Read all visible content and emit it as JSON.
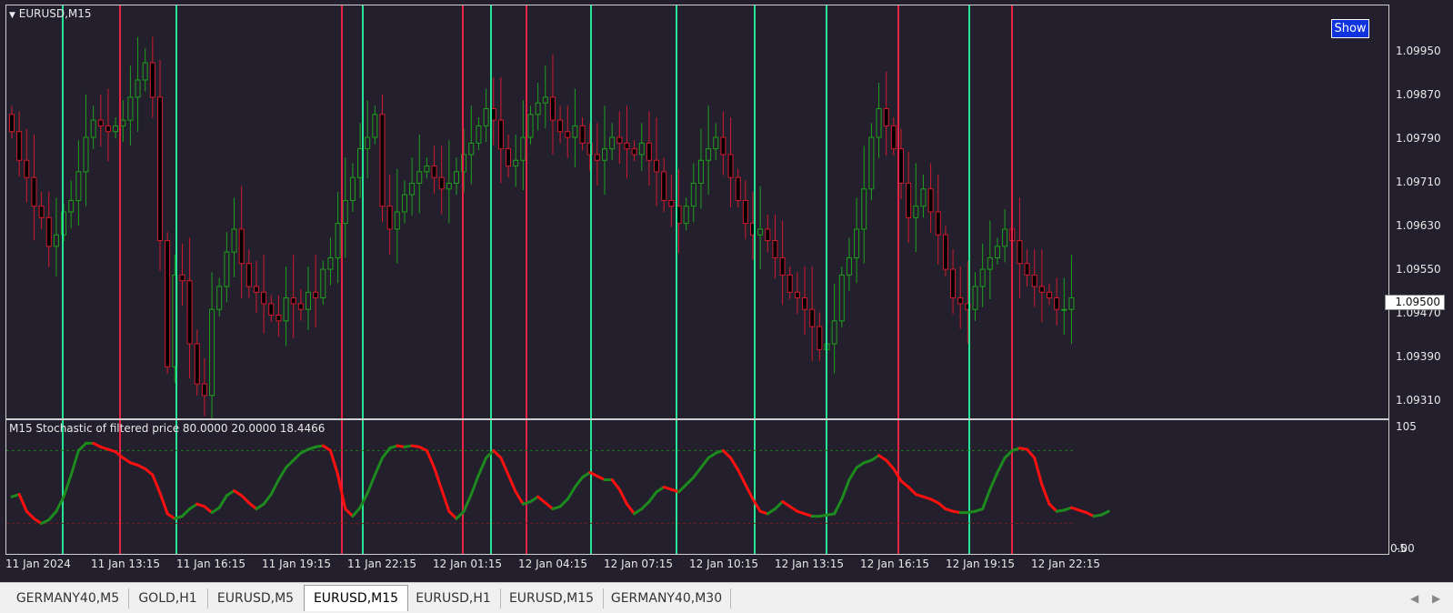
{
  "window": {
    "title": "EURUSD,M15",
    "show_button": "Show",
    "current_price": "1.09500"
  },
  "price_axis": [
    "1.09950",
    "1.09870",
    "1.09790",
    "1.09710",
    "1.09630",
    "1.09550",
    "1.09470",
    "1.09390",
    "1.09310"
  ],
  "indicator": {
    "label": "M15 Stochastic of filtered price 80.0000 20.0000 18.4466",
    "axis_top": "105",
    "axis_bottom": "-5",
    "axis_bottom_overlay": "0.00"
  },
  "time_axis": [
    "11 Jan 2024",
    "11 Jan 13:15",
    "11 Jan 16:15",
    "11 Jan 19:15",
    "11 Jan 22:15",
    "12 Jan 01:15",
    "12 Jan 04:15",
    "12 Jan 07:15",
    "12 Jan 10:15",
    "12 Jan 13:15",
    "12 Jan 16:15",
    "12 Jan 19:15",
    "12 Jan 22:15"
  ],
  "tabs": [
    {
      "label": "GERMANY40,M5"
    },
    {
      "label": "GOLD,H1"
    },
    {
      "label": "EURUSD,M5"
    },
    {
      "label": "EURUSD,M15",
      "active": true
    },
    {
      "label": "EURUSD,H1"
    },
    {
      "label": "EURUSD,M15"
    },
    {
      "label": "GERMANY40,M30"
    }
  ],
  "colors": {
    "background": "#231f2c",
    "bull_line": "#27e398",
    "bear_line": "#e62245",
    "stoch_up": "#1d8a1d",
    "stoch_down": "#ff1010"
  },
  "chart_data": [
    {
      "type": "candlestick",
      "symbol": "EURUSD",
      "timeframe": "M15",
      "ylim": [
        1.0929,
        1.1001
      ],
      "close_series": [
        1.0979,
        1.0974,
        1.0971,
        1.0966,
        1.0964,
        1.0959,
        1.0961,
        1.0965,
        1.0967,
        1.0972,
        1.0978,
        1.0981,
        1.098,
        1.0979,
        1.098,
        1.0981,
        1.0985,
        1.0988,
        1.0991,
        1.0985,
        1.096,
        1.0938,
        1.0954,
        1.0953,
        1.0942,
        1.0935,
        1.0933,
        1.0948,
        1.0952,
        1.0958,
        1.0962,
        1.0956,
        1.0952,
        1.0951,
        1.0949,
        1.0947,
        1.0946,
        1.095,
        1.0949,
        1.0948,
        1.0951,
        1.095,
        1.0955,
        1.0957,
        1.0963,
        1.0967,
        1.0971,
        1.0976,
        1.0978,
        1.0982,
        1.0966,
        1.0962,
        1.0965,
        1.0968,
        1.097,
        1.0972,
        1.0973,
        1.0971,
        1.0969,
        1.097,
        1.0972,
        1.0975,
        1.0977,
        1.098,
        1.0983,
        1.0981,
        1.0976,
        1.0973,
        1.0974,
        1.0978,
        1.0982,
        1.0984,
        1.0985,
        1.0981,
        1.0979,
        1.0978,
        1.098,
        1.0977,
        1.0975,
        1.0974,
        1.0976,
        1.0978,
        1.0977,
        1.0976,
        1.0975,
        1.0977,
        1.0974,
        1.0972,
        1.0967,
        1.0966,
        1.0963,
        1.0966,
        1.097,
        1.0974,
        1.0976,
        1.0978,
        1.0975,
        1.0971,
        1.0967,
        1.0963,
        1.0961,
        1.0962,
        1.096,
        1.0957,
        1.0954,
        1.0951,
        1.095,
        1.0948,
        1.0945,
        1.0941,
        1.0942,
        1.0946,
        1.0954,
        1.0957,
        1.0962,
        1.0969,
        1.0978,
        1.0983,
        1.098,
        1.0976,
        1.097,
        1.0964,
        1.0966,
        1.0969,
        1.0965,
        1.0961,
        1.0955,
        1.095,
        1.0949,
        1.0948,
        1.0952,
        1.0955,
        1.0957,
        1.0959,
        1.0962,
        1.096,
        1.0956,
        1.0954,
        1.0952,
        1.0951,
        1.095,
        1.0948,
        1.0948,
        1.095
      ]
    },
    {
      "type": "line",
      "name": "M15 Stochastic of filtered price",
      "ylim": [
        -5,
        105
      ],
      "levels": [
        80,
        20
      ],
      "values": [
        42,
        44,
        30,
        24,
        20,
        23,
        30,
        42,
        60,
        80,
        86,
        86,
        83,
        81,
        79,
        74,
        70,
        68,
        65,
        60,
        45,
        28,
        24,
        26,
        32,
        36,
        34,
        29,
        33,
        43,
        47,
        43,
        37,
        32,
        36,
        44,
        56,
        66,
        72,
        78,
        81,
        83,
        84,
        80,
        60,
        32,
        26,
        33,
        45,
        60,
        74,
        82,
        84,
        83,
        84,
        83,
        80,
        66,
        48,
        30,
        24,
        30,
        44,
        60,
        74,
        80,
        74,
        60,
        46,
        36,
        38,
        42,
        37,
        32,
        34,
        40,
        50,
        58,
        62,
        59,
        56,
        56,
        48,
        36,
        28,
        32,
        38,
        46,
        50,
        48,
        46,
        52,
        58,
        66,
        74,
        78,
        80,
        74,
        64,
        52,
        40,
        30,
        28,
        32,
        38,
        34,
        30,
        28,
        26,
        26,
        27,
        28,
        40,
        56,
        66,
        70,
        72,
        76,
        72,
        65,
        55,
        50,
        44,
        42,
        40,
        37,
        32,
        30,
        29,
        29,
        30,
        32,
        48,
        62,
        74,
        80,
        82,
        81,
        74,
        52,
        36,
        30,
        31,
        33,
        31,
        29,
        26,
        27,
        30
      ]
    }
  ]
}
